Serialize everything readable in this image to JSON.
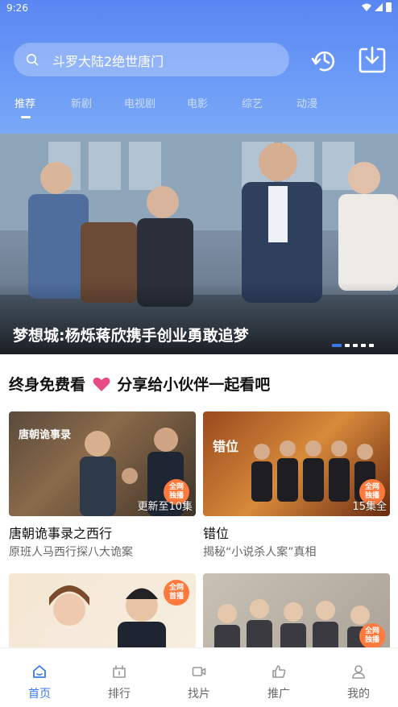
{
  "status_bar": {
    "time": "9:26"
  },
  "search": {
    "query": "斗罗大陆2绝世唐门"
  },
  "tabs": [
    {
      "label": "推荐",
      "active": true
    },
    {
      "label": "新剧",
      "active": false
    },
    {
      "label": "电视剧",
      "active": false
    },
    {
      "label": "电影",
      "active": false
    },
    {
      "label": "综艺",
      "active": false
    },
    {
      "label": "动漫",
      "active": false
    }
  ],
  "banner": {
    "title": "梦想城:杨烁蒋欣携手创业勇敢追梦",
    "slide_count": 5,
    "current_slide": 1
  },
  "section": {
    "title_left": "终身免费看",
    "title_right": "分享给小伙伴一起看吧"
  },
  "cards": [
    {
      "title": "唐朝诡事录之西行",
      "subtitle": "原班人马西行探八大诡案",
      "badge": "更新至10集",
      "tag": "全网\n独播",
      "poster_text": "唐朝诡事录"
    },
    {
      "title": "错位",
      "subtitle": "揭秘“小说杀人案”真相",
      "badge": "15集全",
      "tag": "全网\n独播",
      "poster_text": "错位"
    },
    {
      "title": "",
      "subtitle": "",
      "badge": "",
      "tag": "全网\n首播",
      "poster_text": ""
    },
    {
      "title": "",
      "subtitle": "",
      "badge": "",
      "tag": "全网\n独播",
      "poster_text": ""
    }
  ],
  "bottom_nav": [
    {
      "label": "首页",
      "icon": "home-icon",
      "active": true
    },
    {
      "label": "排行",
      "icon": "ranking-icon",
      "active": false
    },
    {
      "label": "找片",
      "icon": "video-icon",
      "active": false
    },
    {
      "label": "推广",
      "icon": "thumbs-up-icon",
      "active": false
    },
    {
      "label": "我的",
      "icon": "user-icon",
      "active": false
    }
  ],
  "colors": {
    "header": "#5a86f2",
    "accent": "#3a7af3",
    "heart": "#e84a84",
    "tag": "#ff7a3c"
  }
}
